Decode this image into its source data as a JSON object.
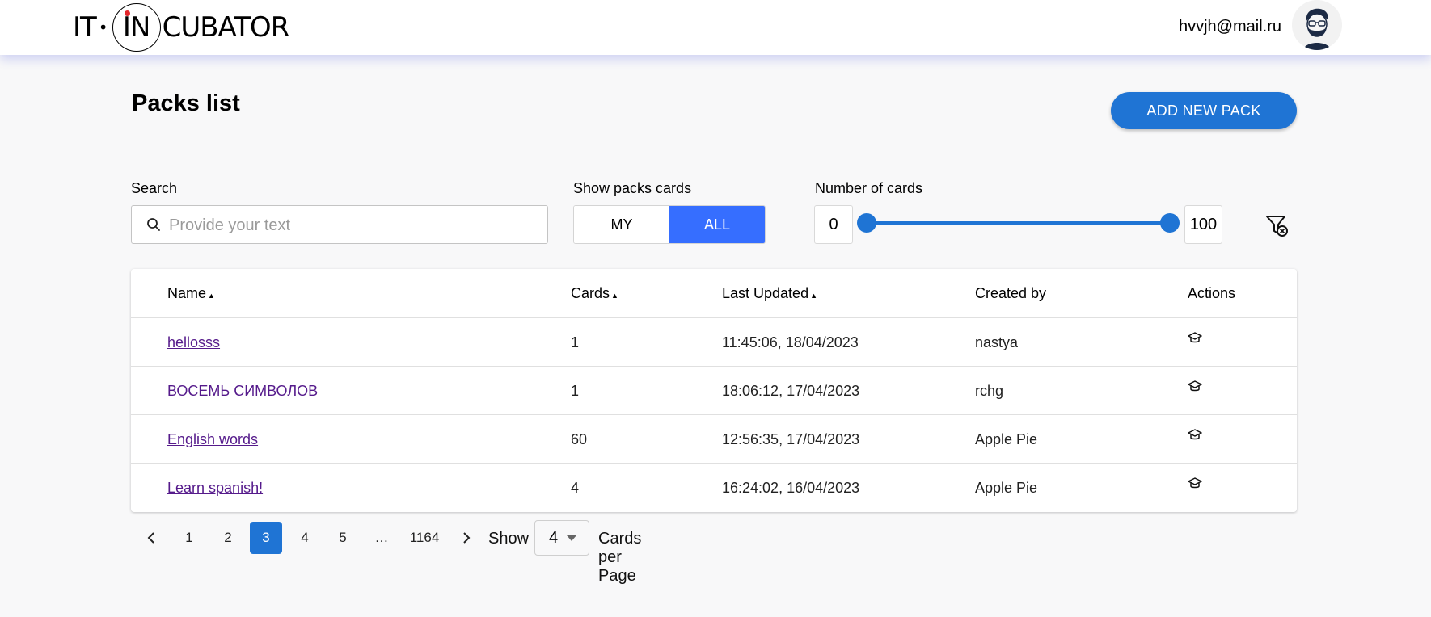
{
  "header": {
    "logo_left": "IT",
    "logo_middle": "IN",
    "logo_right": "CUBATOR",
    "user_email": "hvvjh@mail.ru"
  },
  "main": {
    "title": "Packs list",
    "add_button": "ADD NEW PACK"
  },
  "filters": {
    "search_label": "Search",
    "search_placeholder": "Provide your text",
    "search_value": "",
    "show_label": "Show packs cards",
    "show_options": [
      "MY",
      "ALL"
    ],
    "show_selected": "ALL",
    "cards_label": "Number of cards",
    "cards_min": "0",
    "cards_max": "100"
  },
  "table": {
    "columns": [
      "Name",
      "Cards",
      "Last Updated",
      "Created by",
      "Actions"
    ],
    "rows": [
      {
        "name": "hellosss",
        "cards": "1",
        "updated": "11:45:06, 18/04/2023",
        "created_by": "nastya"
      },
      {
        "name": "ВОСЕМЬ СИМВОЛОВ",
        "cards": "1",
        "updated": "18:06:12, 17/04/2023",
        "created_by": "rchg"
      },
      {
        "name": "English words",
        "cards": "60",
        "updated": "12:56:35, 17/04/2023",
        "created_by": "Apple Pie"
      },
      {
        "name": "Learn spanish!",
        "cards": "4",
        "updated": "16:24:02, 16/04/2023",
        "created_by": "Apple Pie"
      }
    ]
  },
  "pagination": {
    "pages": [
      "1",
      "2",
      "3",
      "4",
      "5",
      "…",
      "1164"
    ],
    "current": "3",
    "show_label": "Show",
    "per_page": "4",
    "per_page_suffix": "Cards per Page"
  },
  "colors": {
    "primary": "#1f74d4",
    "toggle_active": "#366eff",
    "link": "#551a8b",
    "logo_dot": "#e3262b"
  }
}
